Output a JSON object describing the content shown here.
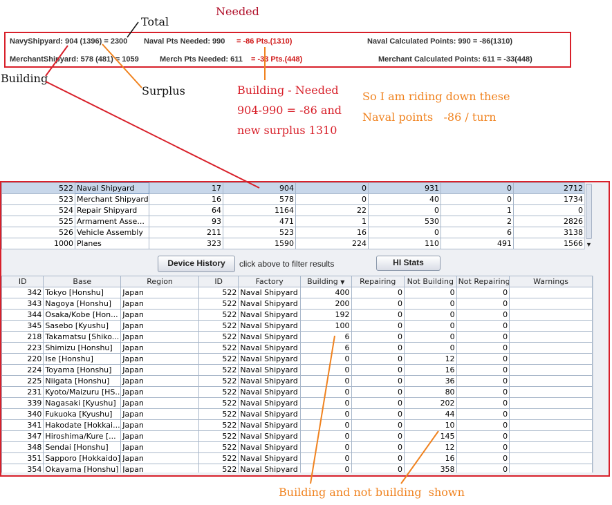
{
  "annotations": {
    "total": "Total",
    "needed": "Needed",
    "building": "Building",
    "surplus": "Surplus",
    "building_needed_1": "Building - Needed",
    "building_needed_2": "904-990 = -86 and",
    "building_needed_3": "new surplus 1310",
    "riding_1": "So I am riding down these",
    "riding_2": "Naval points   -86 / turn",
    "bottom_note": "Building and not building  shown"
  },
  "summary": {
    "navy_shipyard": "NavyShipyard: 904 (1396) = 2300",
    "naval_pts_label": "Naval Pts Needed: 990",
    "naval_pts_value": "= -86 Pts.(1310)",
    "naval_calc": "Naval Calculated Points:  990 = -86(1310)",
    "merchant_shipyard": "MerchantShipyard:  578 (481) = 1059",
    "merch_pts_label": "Merch Pts Needed: 611",
    "merch_pts_value": "= -33 Pts.(448)",
    "merchant_calc": "Merchant Calculated Points:  611 = -33(448)"
  },
  "factory_rows": [
    {
      "id": "522",
      "name": "Naval Shipyard",
      "c1": "17",
      "c2": "904",
      "c3": "0",
      "c4": "931",
      "c5": "0",
      "c6": "2712",
      "selected": true
    },
    {
      "id": "523",
      "name": "Merchant Shipyard",
      "c1": "16",
      "c2": "578",
      "c3": "0",
      "c4": "40",
      "c5": "0",
      "c6": "1734"
    },
    {
      "id": "524",
      "name": "Repair Shipyard",
      "c1": "64",
      "c2": "1164",
      "c3": "22",
      "c4": "0",
      "c5": "1",
      "c6": "0"
    },
    {
      "id": "525",
      "name": "Armament Asse...",
      "c1": "93",
      "c2": "471",
      "c3": "1",
      "c4": "530",
      "c5": "2",
      "c6": "2826"
    },
    {
      "id": "526",
      "name": "Vehicle Assembly",
      "c1": "211",
      "c2": "523",
      "c3": "16",
      "c4": "0",
      "c5": "6",
      "c6": "3138"
    },
    {
      "id": "1000",
      "name": "Planes",
      "c1": "323",
      "c2": "1590",
      "c3": "224",
      "c4": "110",
      "c5": "491",
      "c6": "1566"
    }
  ],
  "buttons": {
    "device_history": "Device History",
    "filter_hint": "click above to filter results",
    "hi_stats": "HI Stats"
  },
  "columns": {
    "id": "ID",
    "base": "Base",
    "region": "Region",
    "id2": "ID",
    "factory": "Factory",
    "building": "Building",
    "sort_icon": "▼",
    "repairing": "Repairing",
    "not_building": "Not Building",
    "not_repairing": "Not Repairing",
    "warnings": "Warnings"
  },
  "base_rows": [
    {
      "id": "342",
      "base": "Tokyo [Honshu]",
      "region": "Japan",
      "fid": "522",
      "factory": "Naval Shipyard",
      "building": "400",
      "repairing": "0",
      "not_building": "0",
      "not_repairing": "0",
      "warnings": ""
    },
    {
      "id": "343",
      "base": "Nagoya [Honshu]",
      "region": "Japan",
      "fid": "522",
      "factory": "Naval Shipyard",
      "building": "200",
      "repairing": "0",
      "not_building": "0",
      "not_repairing": "0",
      "warnings": ""
    },
    {
      "id": "344",
      "base": "Osaka/Kobe [Hon...",
      "region": "Japan",
      "fid": "522",
      "factory": "Naval Shipyard",
      "building": "192",
      "repairing": "0",
      "not_building": "0",
      "not_repairing": "0",
      "warnings": ""
    },
    {
      "id": "345",
      "base": "Sasebo [Kyushu]",
      "region": "Japan",
      "fid": "522",
      "factory": "Naval Shipyard",
      "building": "100",
      "repairing": "0",
      "not_building": "0",
      "not_repairing": "0",
      "warnings": ""
    },
    {
      "id": "218",
      "base": "Takamatsu [Shiko...",
      "region": "Japan",
      "fid": "522",
      "factory": "Naval Shipyard",
      "building": "6",
      "repairing": "0",
      "not_building": "0",
      "not_repairing": "0",
      "warnings": ""
    },
    {
      "id": "223",
      "base": "Shimizu [Honshu]",
      "region": "Japan",
      "fid": "522",
      "factory": "Naval Shipyard",
      "building": "6",
      "repairing": "0",
      "not_building": "0",
      "not_repairing": "0",
      "warnings": ""
    },
    {
      "id": "220",
      "base": "Ise [Honshu]",
      "region": "Japan",
      "fid": "522",
      "factory": "Naval Shipyard",
      "building": "0",
      "repairing": "0",
      "not_building": "12",
      "not_repairing": "0",
      "warnings": ""
    },
    {
      "id": "224",
      "base": "Toyama [Honshu]",
      "region": "Japan",
      "fid": "522",
      "factory": "Naval Shipyard",
      "building": "0",
      "repairing": "0",
      "not_building": "16",
      "not_repairing": "0",
      "warnings": ""
    },
    {
      "id": "225",
      "base": "Niigata [Honshu]",
      "region": "Japan",
      "fid": "522",
      "factory": "Naval Shipyard",
      "building": "0",
      "repairing": "0",
      "not_building": "36",
      "not_repairing": "0",
      "warnings": ""
    },
    {
      "id": "231",
      "base": "Kyoto/Maizuru [HS...",
      "region": "Japan",
      "fid": "522",
      "factory": "Naval Shipyard",
      "building": "0",
      "repairing": "0",
      "not_building": "80",
      "not_repairing": "0",
      "warnings": ""
    },
    {
      "id": "339",
      "base": "Nagasaki [Kyushu]",
      "region": "Japan",
      "fid": "522",
      "factory": "Naval Shipyard",
      "building": "0",
      "repairing": "0",
      "not_building": "202",
      "not_repairing": "0",
      "warnings": ""
    },
    {
      "id": "340",
      "base": "Fukuoka [Kyushu]",
      "region": "Japan",
      "fid": "522",
      "factory": "Naval Shipyard",
      "building": "0",
      "repairing": "0",
      "not_building": "44",
      "not_repairing": "0",
      "warnings": ""
    },
    {
      "id": "341",
      "base": "Hakodate [Hokkai...",
      "region": "Japan",
      "fid": "522",
      "factory": "Naval Shipyard",
      "building": "0",
      "repairing": "0",
      "not_building": "10",
      "not_repairing": "0",
      "warnings": ""
    },
    {
      "id": "347",
      "base": "Hiroshima/Kure [...",
      "region": "Japan",
      "fid": "522",
      "factory": "Naval Shipyard",
      "building": "0",
      "repairing": "0",
      "not_building": "145",
      "not_repairing": "0",
      "warnings": ""
    },
    {
      "id": "348",
      "base": "Sendai [Honshu]",
      "region": "Japan",
      "fid": "522",
      "factory": "Naval Shipyard",
      "building": "0",
      "repairing": "0",
      "not_building": "12",
      "not_repairing": "0",
      "warnings": ""
    },
    {
      "id": "351",
      "base": "Sapporo [Hokkaido]",
      "region": "Japan",
      "fid": "522",
      "factory": "Naval Shipyard",
      "building": "0",
      "repairing": "0",
      "not_building": "16",
      "not_repairing": "0",
      "warnings": ""
    },
    {
      "id": "354",
      "base": "Okayama [Honshu]",
      "region": "Japan",
      "fid": "522",
      "factory": "Naval Shipyard",
      "building": "0",
      "repairing": "0",
      "not_building": "358",
      "not_repairing": "0",
      "warnings": ""
    }
  ],
  "colors": {
    "annotation_red": "#d8202a",
    "annotation_orange": "#f0821e",
    "annotation_dark_red": "#b0102a",
    "selection": "#c8d7ea"
  }
}
